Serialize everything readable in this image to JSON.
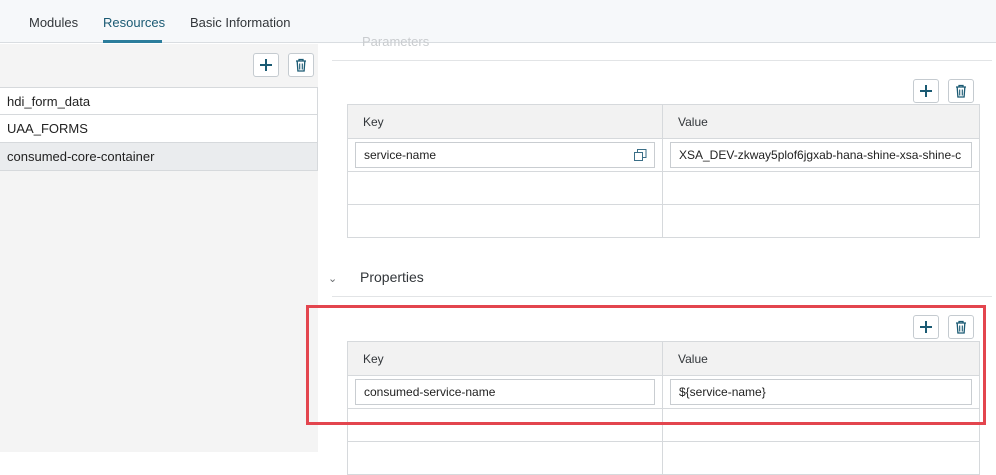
{
  "tabs": [
    {
      "label": "Modules"
    },
    {
      "label": "Resources",
      "active": true
    },
    {
      "label": "Basic Information"
    }
  ],
  "resources": {
    "items": [
      {
        "label": "hdi_form_data"
      },
      {
        "label": "UAA_FORMS"
      },
      {
        "label": "consumed-core-container",
        "selected": true
      }
    ]
  },
  "parameters": {
    "title": "Parameters",
    "columns": {
      "key": "Key",
      "value": "Value"
    },
    "rows": [
      {
        "key": "service-name",
        "value": "XSA_DEV-zkway5plof6jgxab-hana-shine-xsa-shine-c"
      }
    ]
  },
  "properties": {
    "title": "Properties",
    "columns": {
      "key": "Key",
      "value": "Value"
    },
    "rows": [
      {
        "key": "consumed-service-name",
        "value": "${service-name}"
      }
    ]
  },
  "colors": {
    "accent": "#2b7d9c",
    "highlight": "#e3454e",
    "icon": "#1a5a73"
  }
}
